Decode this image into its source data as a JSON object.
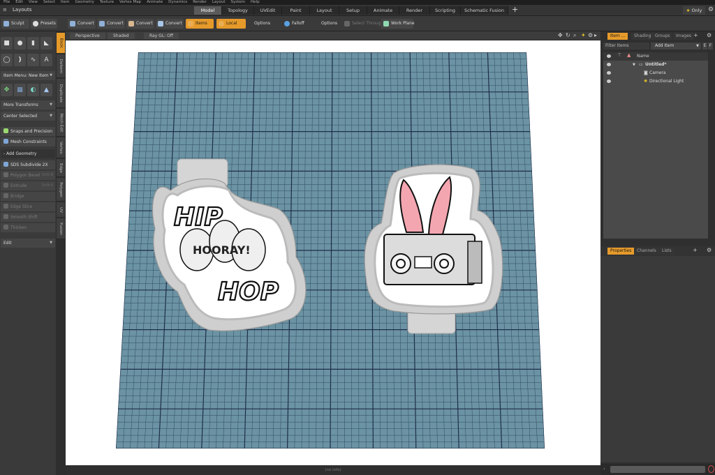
{
  "menubar": {
    "items": [
      "File",
      "Edit",
      "View",
      "Select",
      "Item",
      "Geometry",
      "Texture",
      "Vertex Map",
      "Animate",
      "Dynamics",
      "Render",
      "Layout",
      "System",
      "Help"
    ]
  },
  "layoutbar": {
    "title": "Layouts",
    "tabs": [
      {
        "label": "Model",
        "active": true
      },
      {
        "label": "Topology",
        "active": false
      },
      {
        "label": "UVEdit",
        "active": false
      },
      {
        "label": "Paint",
        "active": false
      },
      {
        "label": "Layout",
        "active": false
      },
      {
        "label": "Setup",
        "active": false
      },
      {
        "label": "Animate",
        "active": false
      },
      {
        "label": "Render",
        "active": false
      },
      {
        "label": "Scripting",
        "active": false
      },
      {
        "label": "Schematic Fusion",
        "active": false
      }
    ],
    "add_label": "+",
    "only_label": "Only"
  },
  "toolbar": {
    "sculpt": "Sculpt",
    "presets": "Presets",
    "convert_labels": [
      "Convert",
      "Convert",
      "Convert",
      "Convert"
    ],
    "items": "Items",
    "local": "Local",
    "options1": "Options",
    "falloff": "Falloff",
    "options2": "Options",
    "select_through": "Select Through",
    "work_plane": "Work Plane"
  },
  "leftpanel": {
    "item_menu": "Item Menu: New Item",
    "more_transforms": "More Transforms",
    "center_selected": "Center Selected",
    "snaps": "Snaps and Precision",
    "mesh_constraints": "Mesh Constraints",
    "add_geometry": "Add Geometry",
    "tools": [
      {
        "label": "SDS Subdivide 2X",
        "shortcut": "",
        "enabled": true
      },
      {
        "label": "Polygon Bevel",
        "shortcut": "Shift-B",
        "enabled": false
      },
      {
        "label": "Extrude",
        "shortcut": "Shift-X",
        "enabled": false
      },
      {
        "label": "Bridge",
        "shortcut": "",
        "enabled": false
      },
      {
        "label": "Edge Slice",
        "shortcut": "",
        "enabled": false
      },
      {
        "label": "Smooth Shift",
        "shortcut": "",
        "enabled": false
      },
      {
        "label": "Thicken",
        "shortcut": "",
        "enabled": false
      }
    ],
    "edit": "Edit"
  },
  "vtabs": [
    "Basic",
    "Deform",
    "Duplicate",
    "Mesh Edit",
    "Vertex",
    "Edge",
    "Polygon",
    "UV",
    "Fusion"
  ],
  "viewport": {
    "header": {
      "perspective": "Perspective",
      "shaded": "Shaded",
      "raygl": "Ray GL: Off"
    },
    "status": "(no info)",
    "cutter_left": {
      "line1": "HIP",
      "line2": "HOORAY!",
      "line3": "HOP"
    }
  },
  "rightpanel": {
    "tabs": [
      {
        "label": "Item ...",
        "active": true
      },
      {
        "label": "Shading",
        "active": false
      },
      {
        "label": "Groups",
        "active": false
      },
      {
        "label": "Images",
        "active": false
      }
    ],
    "filter_label": "Filter Items",
    "add_item": "Add Item",
    "col_name": "Name",
    "tree": [
      {
        "label": "Untitled*",
        "indent": 0
      },
      {
        "label": "Camera",
        "indent": 1
      },
      {
        "label": "Directional Light",
        "indent": 1
      }
    ],
    "bottom_tabs": [
      {
        "label": "Properties",
        "active": true
      },
      {
        "label": "Channels",
        "active": false
      },
      {
        "label": "Lists",
        "active": false
      }
    ]
  },
  "colors": {
    "accent": "#e59a2a",
    "grid_fill": "#6b93a3",
    "grid_major": "#1e2d4a",
    "grid_minor": "#2f4a62"
  }
}
